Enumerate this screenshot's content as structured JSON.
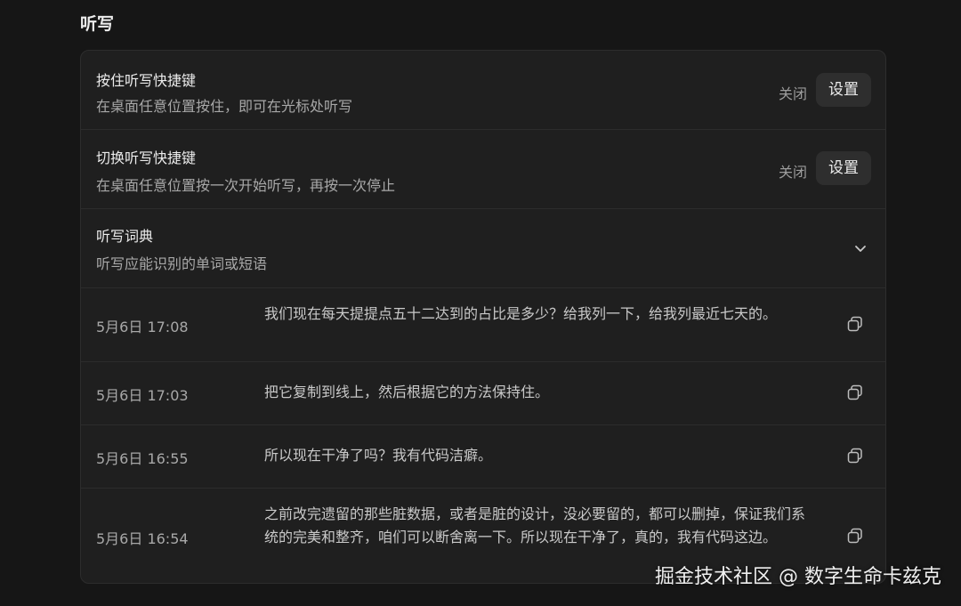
{
  "section": {
    "title": "听写"
  },
  "settings": [
    {
      "title": "按住听写快捷键",
      "desc": "在桌面任意位置按住，即可在光标处听写",
      "status": "关闭",
      "button": "设置"
    },
    {
      "title": "切换听写快捷键",
      "desc": "在桌面任意位置按一次开始听写，再按一次停止",
      "status": "关闭",
      "button": "设置"
    }
  ],
  "dictionary": {
    "title": "听写词典",
    "desc": "听写应能识别的单词或短语",
    "icon": "chevron-down-icon"
  },
  "history": [
    {
      "time": "5月6日 17:08",
      "text": "我们现在每天提提点五十二达到的占比是多少？给我列一下，给我列最近七天的。",
      "icon": "copy-icon"
    },
    {
      "time": "5月6日 17:03",
      "text": "把它复制到线上，然后根据它的方法保持住。",
      "icon": "copy-icon"
    },
    {
      "time": "5月6日 16:55",
      "text": "所以现在干净了吗？我有代码洁癖。",
      "icon": "copy-icon"
    },
    {
      "time": "5月6日 16:54",
      "text": "之前改完遗留的那些脏数据，或者是脏的设计，没必要留的，都可以删掉，保证我们系统的完美和整齐，咱们可以断舍离一下。所以现在干净了，真的，我有代码这边。",
      "icon": "copy-icon"
    }
  ],
  "watermark": "掘金技术社区 @ 数字生命卡兹克",
  "colors": {
    "background": "#161616",
    "panel": "#1f1f1f",
    "button": "#2e2e2e",
    "divider": "#2c2c2c"
  }
}
